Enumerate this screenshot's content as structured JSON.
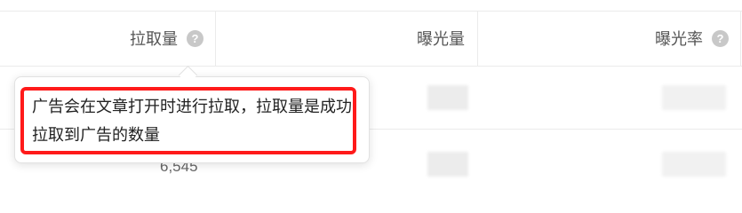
{
  "table": {
    "columns": [
      {
        "label": "拉取量",
        "help_icon": "question-circle-icon"
      },
      {
        "label": "曝光量"
      },
      {
        "label": "曝光率",
        "help_icon": "question-circle-icon"
      }
    ],
    "partial_cell_text": "6,545"
  },
  "tooltip": {
    "text": "广告会在文章打开时进行拉取，拉取量是成功拉取到广告的数量",
    "highlight_color": "#ff1a1a"
  }
}
